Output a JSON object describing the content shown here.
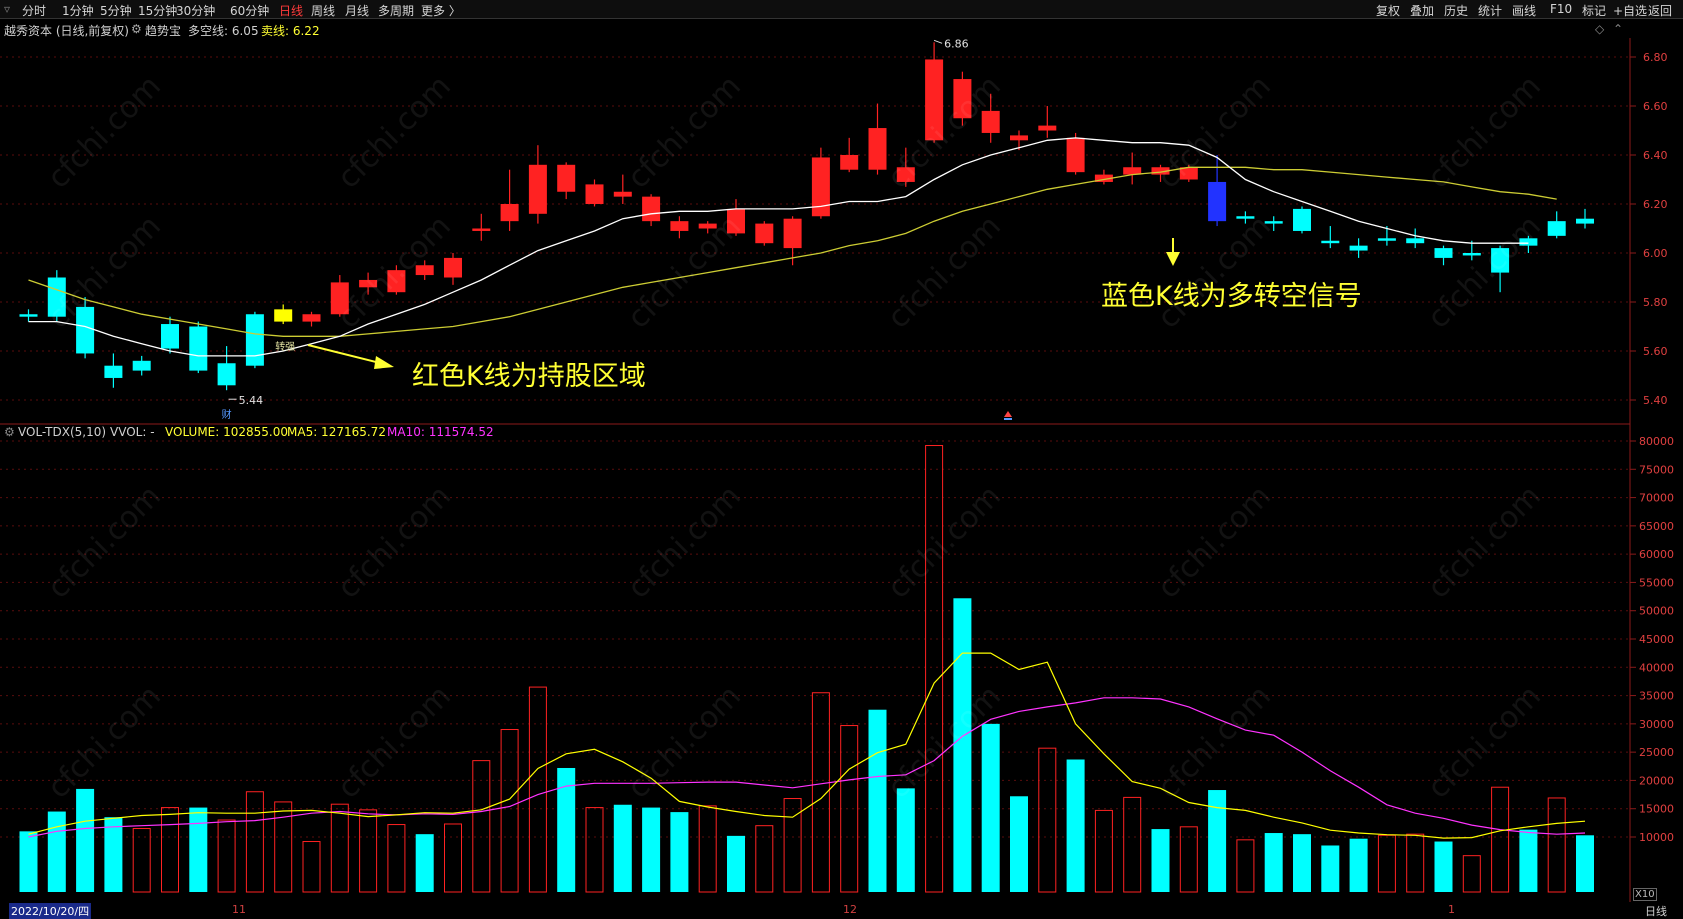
{
  "toolbar": {
    "periods": [
      "分时",
      "1分钟",
      "5分钟",
      "15分钟",
      "30分钟",
      "60分钟",
      "日线",
      "周线",
      "月线",
      "多周期",
      "更多 〉"
    ],
    "active_period": "日线",
    "right_buttons": [
      "复权",
      "叠加",
      "历史",
      "统计",
      "画线",
      "F10",
      "标记",
      "+自选",
      "返回"
    ]
  },
  "info": {
    "title": "越秀资本 (日线,前复权)",
    "indicator": "趋势宝",
    "long_short_label": "多空线: 6.05",
    "sell_label": "卖线: 6.22"
  },
  "price_axis": [
    "6.80",
    "6.60",
    "6.40",
    "6.20",
    "6.00",
    "5.80",
    "5.60",
    "5.40"
  ],
  "volume_axis": [
    "80000",
    "75000",
    "70000",
    "65000",
    "60000",
    "55000",
    "50000",
    "45000",
    "40000",
    "35000",
    "30000",
    "25000",
    "20000",
    "15000",
    "10000"
  ],
  "volume_header": {
    "name": "VOL-TDX(5,10)",
    "vvol": "VVOL: -",
    "volume": "VOLUME: 102855.00",
    "ma5": "MA5: 127165.72",
    "ma10": "MA10: 111574.52"
  },
  "annotations": {
    "red_text": "红色K线为持股区域",
    "blue_text": "蓝色K线为多转空信号",
    "high_label": "6.86",
    "low_label": "5.44",
    "turn_label": "转强",
    "cai_label": "财"
  },
  "bottom": {
    "date": "2022/10/20/四",
    "months": [
      "11",
      "12",
      "1"
    ],
    "right_label": "日线",
    "x10": "X10"
  },
  "colors": {
    "up": "#ff2222",
    "down": "#00ffff",
    "signal_blue": "#2233ff",
    "signal_yellow": "#ffff00",
    "ma_white": "#ffffff",
    "ma_yellow": "#cccc33",
    "vol_ma5": "#ffff00",
    "vol_ma10": "#ff33ff",
    "annotation": "#ffff33"
  },
  "chart_data": {
    "type": "candlestick",
    "candles": [
      {
        "o": 5.74,
        "c": 5.75,
        "h": 5.77,
        "l": 5.72,
        "col": "cyan"
      },
      {
        "o": 5.9,
        "c": 5.74,
        "h": 5.93,
        "l": 5.72,
        "col": "cyan"
      },
      {
        "o": 5.78,
        "c": 5.59,
        "h": 5.82,
        "l": 5.57,
        "col": "cyan"
      },
      {
        "o": 5.54,
        "c": 5.49,
        "h": 5.59,
        "l": 5.45,
        "col": "cyan"
      },
      {
        "o": 5.56,
        "c": 5.52,
        "h": 5.58,
        "l": 5.5,
        "col": "cyan"
      },
      {
        "o": 5.71,
        "c": 5.61,
        "h": 5.74,
        "l": 5.59,
        "col": "cyan"
      },
      {
        "o": 5.7,
        "c": 5.52,
        "h": 5.72,
        "l": 5.51,
        "col": "cyan"
      },
      {
        "o": 5.55,
        "c": 5.46,
        "h": 5.62,
        "l": 5.44,
        "col": "cyan"
      },
      {
        "o": 5.75,
        "c": 5.54,
        "h": 5.76,
        "l": 5.53,
        "col": "cyan"
      },
      {
        "o": 5.72,
        "c": 5.77,
        "h": 5.79,
        "l": 5.71,
        "col": "yellow"
      },
      {
        "o": 5.72,
        "c": 5.75,
        "h": 5.76,
        "l": 5.7,
        "col": "red"
      },
      {
        "o": 5.75,
        "c": 5.88,
        "h": 5.91,
        "l": 5.74,
        "col": "red"
      },
      {
        "o": 5.86,
        "c": 5.89,
        "h": 5.92,
        "l": 5.83,
        "col": "red"
      },
      {
        "o": 5.84,
        "c": 5.93,
        "h": 5.95,
        "l": 5.83,
        "col": "red"
      },
      {
        "o": 5.91,
        "c": 5.95,
        "h": 5.97,
        "l": 5.89,
        "col": "red"
      },
      {
        "o": 5.9,
        "c": 5.98,
        "h": 6.0,
        "l": 5.87,
        "col": "red"
      },
      {
        "o": 6.09,
        "c": 6.1,
        "h": 6.16,
        "l": 6.05,
        "col": "red"
      },
      {
        "o": 6.13,
        "c": 6.2,
        "h": 6.34,
        "l": 6.09,
        "col": "red"
      },
      {
        "o": 6.16,
        "c": 6.36,
        "h": 6.44,
        "l": 6.12,
        "col": "red"
      },
      {
        "o": 6.36,
        "c": 6.25,
        "h": 6.37,
        "l": 6.22,
        "col": "red"
      },
      {
        "o": 6.28,
        "c": 6.2,
        "h": 6.3,
        "l": 6.19,
        "col": "red"
      },
      {
        "o": 6.23,
        "c": 6.25,
        "h": 6.32,
        "l": 6.2,
        "col": "red"
      },
      {
        "o": 6.23,
        "c": 6.13,
        "h": 6.24,
        "l": 6.11,
        "col": "red"
      },
      {
        "o": 6.13,
        "c": 6.09,
        "h": 6.15,
        "l": 6.06,
        "col": "red"
      },
      {
        "o": 6.1,
        "c": 6.12,
        "h": 6.13,
        "l": 6.08,
        "col": "red"
      },
      {
        "o": 6.08,
        "c": 6.18,
        "h": 6.22,
        "l": 6.07,
        "col": "red"
      },
      {
        "o": 6.04,
        "c": 6.12,
        "h": 6.13,
        "l": 6.03,
        "col": "red"
      },
      {
        "o": 6.02,
        "c": 6.14,
        "h": 6.15,
        "l": 5.95,
        "col": "red"
      },
      {
        "o": 6.15,
        "c": 6.39,
        "h": 6.43,
        "l": 6.14,
        "col": "red"
      },
      {
        "o": 6.34,
        "c": 6.4,
        "h": 6.47,
        "l": 6.33,
        "col": "red"
      },
      {
        "o": 6.34,
        "c": 6.51,
        "h": 6.61,
        "l": 6.32,
        "col": "red"
      },
      {
        "o": 6.29,
        "c": 6.35,
        "h": 6.43,
        "l": 6.27,
        "col": "red"
      },
      {
        "o": 6.46,
        "c": 6.79,
        "h": 6.86,
        "l": 6.45,
        "col": "red"
      },
      {
        "o": 6.55,
        "c": 6.71,
        "h": 6.74,
        "l": 6.52,
        "col": "red"
      },
      {
        "o": 6.49,
        "c": 6.58,
        "h": 6.65,
        "l": 6.45,
        "col": "red"
      },
      {
        "o": 6.46,
        "c": 6.48,
        "h": 6.5,
        "l": 6.42,
        "col": "red"
      },
      {
        "o": 6.5,
        "c": 6.52,
        "h": 6.6,
        "l": 6.47,
        "col": "red"
      },
      {
        "o": 6.33,
        "c": 6.47,
        "h": 6.49,
        "l": 6.32,
        "col": "red"
      },
      {
        "o": 6.29,
        "c": 6.32,
        "h": 6.34,
        "l": 6.28,
        "col": "red"
      },
      {
        "o": 6.32,
        "c": 6.35,
        "h": 6.41,
        "l": 6.28,
        "col": "red"
      },
      {
        "o": 6.32,
        "c": 6.35,
        "h": 6.36,
        "l": 6.29,
        "col": "red"
      },
      {
        "o": 6.3,
        "c": 6.35,
        "h": 6.36,
        "l": 6.29,
        "col": "red"
      },
      {
        "o": 6.29,
        "c": 6.13,
        "h": 6.4,
        "l": 6.11,
        "col": "blue"
      },
      {
        "o": 6.15,
        "c": 6.14,
        "h": 6.17,
        "l": 6.12,
        "col": "cyan"
      },
      {
        "o": 6.13,
        "c": 6.12,
        "h": 6.15,
        "l": 6.09,
        "col": "cyan"
      },
      {
        "o": 6.18,
        "c": 6.09,
        "h": 6.19,
        "l": 6.08,
        "col": "cyan"
      },
      {
        "o": 6.05,
        "c": 6.04,
        "h": 6.11,
        "l": 6.02,
        "col": "cyan"
      },
      {
        "o": 6.03,
        "c": 6.01,
        "h": 6.06,
        "l": 5.98,
        "col": "cyan"
      },
      {
        "o": 6.06,
        "c": 6.05,
        "h": 6.11,
        "l": 6.03,
        "col": "cyan"
      },
      {
        "o": 6.06,
        "c": 6.04,
        "h": 6.1,
        "l": 6.02,
        "col": "cyan"
      },
      {
        "o": 6.02,
        "c": 5.98,
        "h": 6.03,
        "l": 5.95,
        "col": "cyan"
      },
      {
        "o": 6.0,
        "c": 5.99,
        "h": 6.05,
        "l": 5.97,
        "col": "cyan"
      },
      {
        "o": 6.02,
        "c": 5.92,
        "h": 6.03,
        "l": 5.84,
        "col": "cyan"
      },
      {
        "o": 6.06,
        "c": 6.03,
        "h": 6.07,
        "l": 6.0,
        "col": "cyan"
      },
      {
        "o": 6.13,
        "c": 6.07,
        "h": 6.17,
        "l": 6.06,
        "col": "cyan"
      },
      {
        "o": 6.14,
        "c": 6.12,
        "h": 6.18,
        "l": 6.1,
        "col": "cyan"
      }
    ],
    "ma_white": [
      5.72,
      5.72,
      5.7,
      5.66,
      5.63,
      5.6,
      5.58,
      5.58,
      5.58,
      5.6,
      5.63,
      5.66,
      5.71,
      5.75,
      5.79,
      5.84,
      5.89,
      5.95,
      6.01,
      6.05,
      6.09,
      6.14,
      6.16,
      6.17,
      6.17,
      6.18,
      6.18,
      6.18,
      6.19,
      6.21,
      6.21,
      6.23,
      6.3,
      6.36,
      6.4,
      6.43,
      6.46,
      6.47,
      6.46,
      6.45,
      6.45,
      6.44,
      6.39,
      6.3,
      6.25,
      6.21,
      6.17,
      6.13,
      6.1,
      6.07,
      6.05,
      6.04,
      6.04,
      6.04
    ],
    "ma_yellow": [
      5.89,
      5.85,
      5.81,
      5.78,
      5.75,
      5.73,
      5.71,
      5.69,
      5.67,
      5.66,
      5.66,
      5.66,
      5.67,
      5.68,
      5.69,
      5.7,
      5.72,
      5.74,
      5.77,
      5.8,
      5.83,
      5.86,
      5.88,
      5.9,
      5.92,
      5.94,
      5.96,
      5.98,
      6.0,
      6.03,
      6.05,
      6.08,
      6.13,
      6.17,
      6.2,
      6.23,
      6.26,
      6.28,
      6.3,
      6.32,
      6.33,
      6.35,
      6.35,
      6.35,
      6.34,
      6.34,
      6.33,
      6.32,
      6.31,
      6.3,
      6.29,
      6.27,
      6.25,
      6.24,
      6.22
    ],
    "volumes": [
      {
        "v": 11000,
        "col": "cyan"
      },
      {
        "v": 14500,
        "col": "cyan"
      },
      {
        "v": 18500,
        "col": "cyan"
      },
      {
        "v": 13500,
        "col": "cyan"
      },
      {
        "v": 11500,
        "col": "red"
      },
      {
        "v": 15200,
        "col": "red"
      },
      {
        "v": 15200,
        "col": "cyan"
      },
      {
        "v": 13000,
        "col": "red"
      },
      {
        "v": 18000,
        "col": "red"
      },
      {
        "v": 16200,
        "col": "red"
      },
      {
        "v": 9200,
        "col": "red"
      },
      {
        "v": 15800,
        "col": "red"
      },
      {
        "v": 14800,
        "col": "red"
      },
      {
        "v": 12200,
        "col": "red"
      },
      {
        "v": 10500,
        "col": "cyan"
      },
      {
        "v": 12300,
        "col": "red"
      },
      {
        "v": 23500,
        "col": "red"
      },
      {
        "v": 29000,
        "col": "red"
      },
      {
        "v": 36500,
        "col": "red"
      },
      {
        "v": 22200,
        "col": "cyan"
      },
      {
        "v": 15200,
        "col": "red"
      },
      {
        "v": 15700,
        "col": "cyan"
      },
      {
        "v": 15200,
        "col": "cyan"
      },
      {
        "v": 14400,
        "col": "cyan"
      },
      {
        "v": 15500,
        "col": "red"
      },
      {
        "v": 10200,
        "col": "cyan"
      },
      {
        "v": 12000,
        "col": "red"
      },
      {
        "v": 16800,
        "col": "red"
      },
      {
        "v": 35500,
        "col": "red"
      },
      {
        "v": 29700,
        "col": "red"
      },
      {
        "v": 32500,
        "col": "cyan"
      },
      {
        "v": 18600,
        "col": "cyan"
      },
      {
        "v": 79200,
        "col": "red"
      },
      {
        "v": 52200,
        "col": "cyan"
      },
      {
        "v": 30000,
        "col": "cyan"
      },
      {
        "v": 17200,
        "col": "cyan"
      },
      {
        "v": 25700,
        "col": "red"
      },
      {
        "v": 23700,
        "col": "cyan"
      },
      {
        "v": 14700,
        "col": "red"
      },
      {
        "v": 17000,
        "col": "red"
      },
      {
        "v": 11400,
        "col": "cyan"
      },
      {
        "v": 11800,
        "col": "red"
      },
      {
        "v": 18300,
        "col": "cyan"
      },
      {
        "v": 9500,
        "col": "red"
      },
      {
        "v": 10700,
        "col": "cyan"
      },
      {
        "v": 10500,
        "col": "cyan"
      },
      {
        "v": 8500,
        "col": "cyan"
      },
      {
        "v": 9700,
        "col": "cyan"
      },
      {
        "v": 10300,
        "col": "red"
      },
      {
        "v": 10500,
        "col": "red"
      },
      {
        "v": 9200,
        "col": "cyan"
      },
      {
        "v": 6700,
        "col": "red"
      },
      {
        "v": 18800,
        "col": "red"
      },
      {
        "v": 11300,
        "col": "cyan"
      },
      {
        "v": 16900,
        "col": "red"
      },
      {
        "v": 10300,
        "col": "cyan"
      }
    ],
    "vol_ma5": [
      10500,
      11800,
      12800,
      13300,
      13800,
      14000,
      14300,
      14200,
      14200,
      14600,
      14700,
      14200,
      13600,
      13900,
      14300,
      14200,
      14800,
      16700,
      22100,
      24700,
      25500,
      23300,
      20400,
      16300,
      15300,
      14500,
      13800,
      13500,
      16800,
      22000,
      24900,
      26400,
      37200,
      42500,
      42500,
      39600,
      40900,
      30000,
      24700,
      19800,
      18600,
      16100,
      15200,
      14700,
      13500,
      12500,
      11200,
      10700,
      10400,
      10300,
      9800,
      9900,
      11100,
      11800,
      12400,
      12800
    ],
    "vol_ma10": [
      10000,
      11000,
      11500,
      11800,
      12000,
      12200,
      12400,
      12700,
      12900,
      13500,
      14200,
      14500,
      14100,
      13900,
      14100,
      14000,
      14500,
      15400,
      17500,
      19000,
      19500,
      19500,
      19500,
      19600,
      19700,
      19700,
      19200,
      18700,
      19400,
      20100,
      20700,
      21000,
      23500,
      27800,
      30800,
      32200,
      33000,
      33700,
      34600,
      34600,
      34400,
      33000,
      30900,
      28900,
      28000,
      25000,
      21700,
      18800,
      15700,
      14200,
      13300,
      12100,
      11300,
      10800,
      10500,
      10700
    ]
  }
}
